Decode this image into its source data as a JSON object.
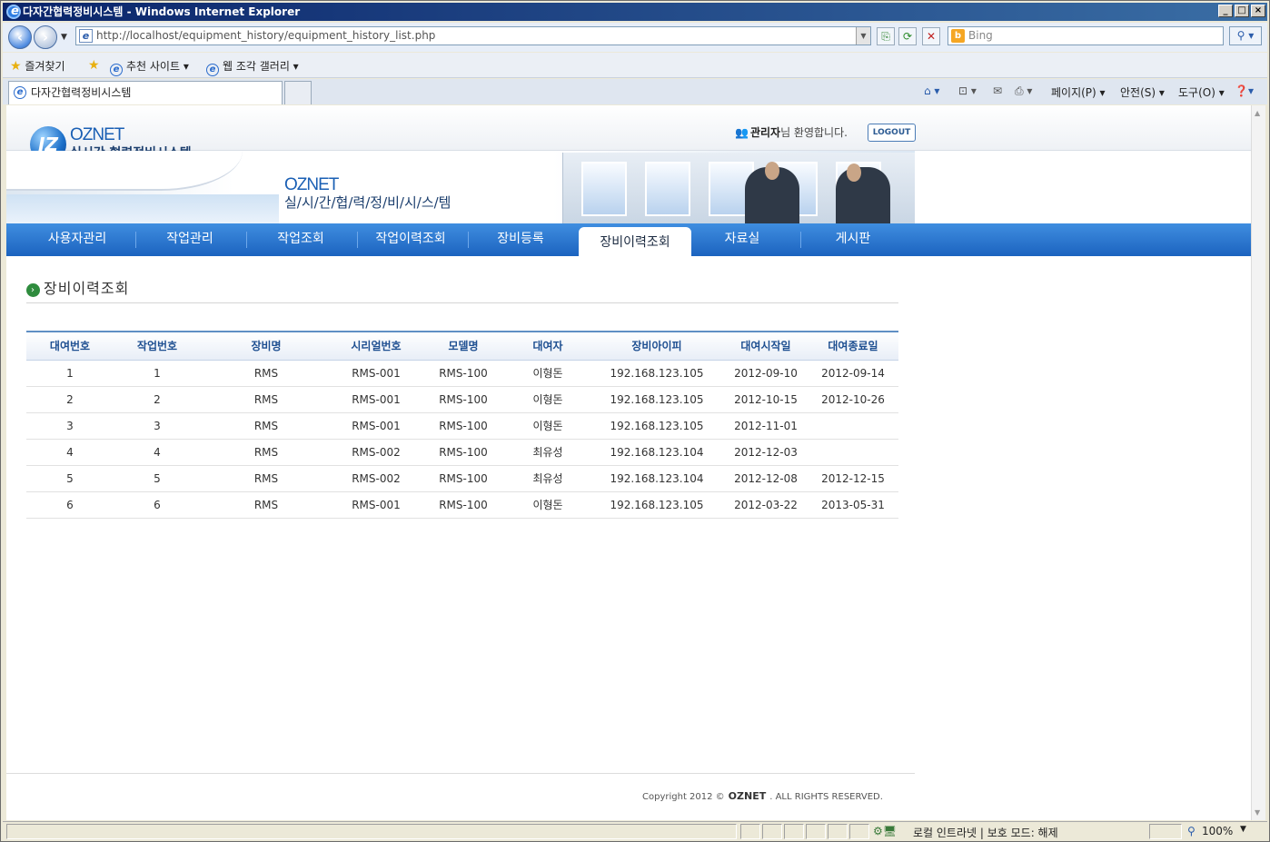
{
  "window": {
    "title": "다자간협력정비시스템 - Windows Internet Explorer"
  },
  "browser": {
    "url": "http://localhost/equipment_history/equipment_history_list.php",
    "search_placeholder": "Bing",
    "favorites_label": "즐겨찾기",
    "fav_items": [
      "추천 사이트 ▾",
      "웹 조각 갤러리 ▾"
    ],
    "tab_title": "다자간협력정비시스템",
    "commands": [
      "페이지(P) ▾",
      "안전(S) ▾",
      "도구(O) ▾"
    ]
  },
  "site": {
    "logo_name": "OZNET",
    "logo_sub": "실시간 협력정비시스템",
    "welcome_user": "관리자",
    "welcome_suffix": "님 환영합니다.",
    "logout_label": "LOGOUT",
    "banner_title": "OZNET",
    "banner_sub": "실/시/간/협/력/정/비/시/스/템",
    "nav": [
      "사용자관리",
      "작업관리",
      "작업조회",
      "작업이력조회",
      "장비등록",
      "장비이력조회",
      "자료실",
      "게시판"
    ],
    "active_nav": "장비이력조회"
  },
  "page": {
    "title": "장비이력조회"
  },
  "table": {
    "columns": [
      "대여번호",
      "작업번호",
      "장비명",
      "시리얼번호",
      "모델명",
      "대여자",
      "장비아이피",
      "대여시작일",
      "대여종료일"
    ],
    "rows": [
      [
        "1",
        "1",
        "RMS",
        "RMS-001",
        "RMS-100",
        "이형돈",
        "192.168.123.105",
        "2012-09-10",
        "2012-09-14"
      ],
      [
        "2",
        "2",
        "RMS",
        "RMS-001",
        "RMS-100",
        "이형돈",
        "192.168.123.105",
        "2012-10-15",
        "2012-10-26"
      ],
      [
        "3",
        "3",
        "RMS",
        "RMS-001",
        "RMS-100",
        "이형돈",
        "192.168.123.105",
        "2012-11-01",
        ""
      ],
      [
        "4",
        "4",
        "RMS",
        "RMS-002",
        "RMS-100",
        "최유성",
        "192.168.123.104",
        "2012-12-03",
        ""
      ],
      [
        "5",
        "5",
        "RMS",
        "RMS-002",
        "RMS-100",
        "최유성",
        "192.168.123.104",
        "2012-12-08",
        "2012-12-15"
      ],
      [
        "6",
        "6",
        "RMS",
        "RMS-001",
        "RMS-100",
        "이형돈",
        "192.168.123.105",
        "2012-03-22",
        "2013-05-31"
      ]
    ]
  },
  "footer": {
    "copyright": "Copyright 2012 ©",
    "logo": "OZNET",
    "rights": ". ALL RIGHTS RESERVED."
  },
  "statusbar": {
    "zone": "로컬 인트라넷 | 보호 모드: 해제",
    "zoom": "100%"
  }
}
